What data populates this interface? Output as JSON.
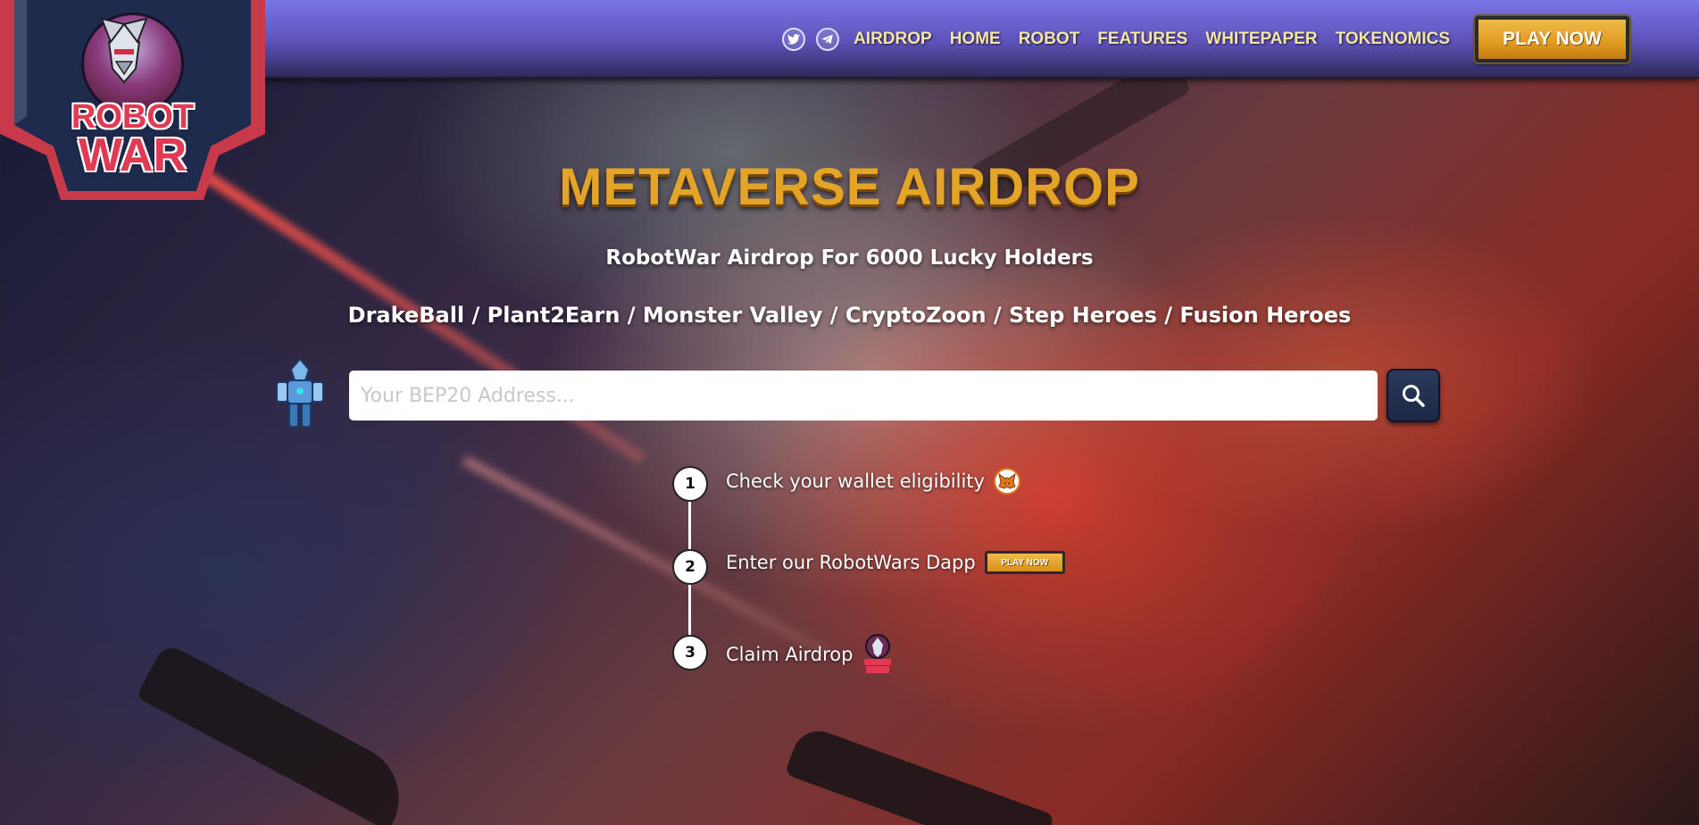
{
  "brand": {
    "logo_line1": "ROBOT",
    "logo_line2": "WAR",
    "logo_alt": "Robot War logo",
    "badge_color": "#1f2b4d",
    "badge_accent": "#c83a4a"
  },
  "nav": {
    "social": [
      {
        "icon": "twitter-icon"
      },
      {
        "icon": "telegram-icon"
      }
    ],
    "links": [
      "AIRDROP",
      "HOME",
      "ROBOT",
      "FEATURES",
      "WHITEPAPER",
      "TOKENOMICS"
    ],
    "cta": "PLAY NOW"
  },
  "hero": {
    "title": "METAVERSE AIRDROP",
    "subtitle": "RobotWar Airdrop For 6000 Lucky Holders",
    "partners": "DrakeBall / Plant2Earn / Monster Valley / CryptoZoon / Step Heroes / Fusion Heroes"
  },
  "search": {
    "placeholder": "Your BEP20 Address...",
    "value": "",
    "button_icon": "search-icon"
  },
  "steps": [
    {
      "num": "1",
      "label": "Check your wallet eligibility",
      "icon": "metamask-fox-icon"
    },
    {
      "num": "2",
      "label": "Enter our RobotWars Dapp",
      "button": "PLAY NOW"
    },
    {
      "num": "3",
      "label": "Claim Airdrop",
      "icon": "robot-war-mini-logo"
    }
  ],
  "colors": {
    "nav_link": "#f3e7a0",
    "cta_gold": "#e8a830",
    "title_gold": "#e4a428"
  }
}
